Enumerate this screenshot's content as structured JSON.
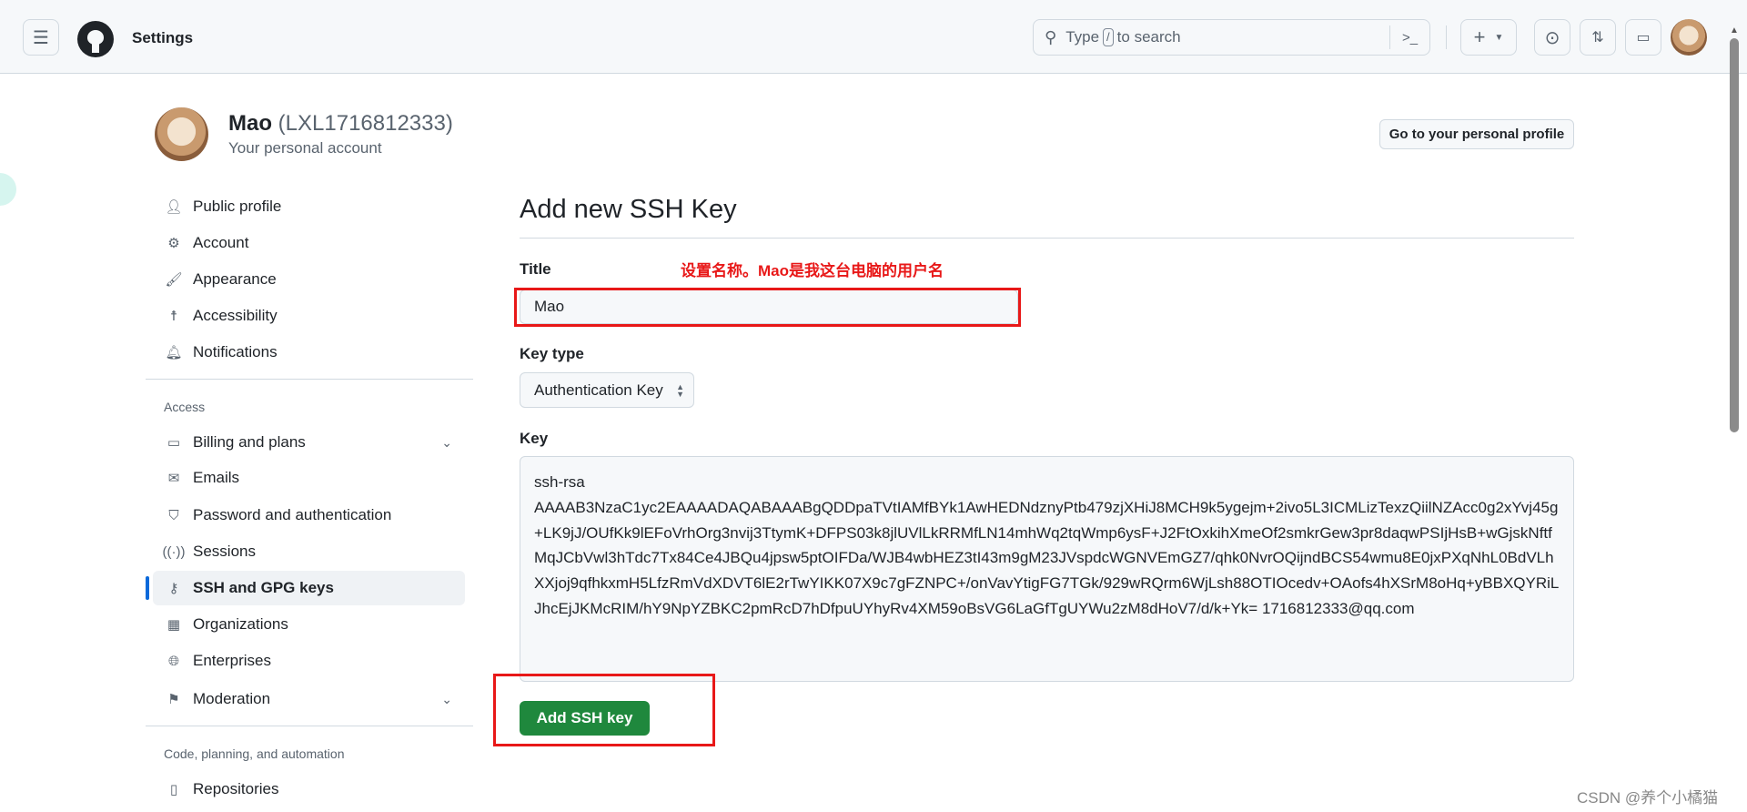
{
  "header": {
    "title": "Settings",
    "search_placeholder_pre": "Type",
    "search_key": "/",
    "search_placeholder_post": "to search"
  },
  "account": {
    "name": "Mao",
    "login": "(LXL1716812333)",
    "subtitle": "Your personal account",
    "profile_button": "Go to your personal profile"
  },
  "sidebar": {
    "items": [
      {
        "label": "Public profile",
        "icon": "person-icon"
      },
      {
        "label": "Account",
        "icon": "gear-icon"
      },
      {
        "label": "Appearance",
        "icon": "paintbrush-icon"
      },
      {
        "label": "Accessibility",
        "icon": "accessibility-icon"
      },
      {
        "label": "Notifications",
        "icon": "bell-icon"
      }
    ],
    "access_heading": "Access",
    "access_items": [
      {
        "label": "Billing and plans",
        "icon": "credit-card-icon"
      },
      {
        "label": "Emails",
        "icon": "mail-icon"
      },
      {
        "label": "Password and authentication",
        "icon": "shield-icon"
      },
      {
        "label": "Sessions",
        "icon": "broadcast-icon"
      },
      {
        "label": "SSH and GPG keys",
        "icon": "key-icon",
        "selected": true
      },
      {
        "label": "Organizations",
        "icon": "organization-icon"
      },
      {
        "label": "Enterprises",
        "icon": "globe-icon"
      },
      {
        "label": "Moderation",
        "icon": "report-icon"
      }
    ],
    "code_heading": "Code, planning, and automation",
    "code_items": [
      {
        "label": "Repositories",
        "icon": "repo-icon"
      }
    ]
  },
  "main": {
    "heading": "Add new SSH Key",
    "title_label": "Title",
    "title_value": "Mao",
    "annotation": "设置名称。Mao是我这台电脑的用户名",
    "key_type_label": "Key type",
    "key_type_value": "Authentication Key",
    "key_label": "Key",
    "key_value": "ssh-rsa\nAAAAB3NzaC1yc2EAAAADAQABAAABgQDDpaTVtIAMfBYk1AwHEDNdznyPtb479zjXHiJ8MCH9k5ygejm+2ivo5L3ICMLizTexzQiilNZAcc0g2xYvj45g+LK9jJ/OUfKk9lEFoVrhOrg3nvij3TtymK+DFPS03k8jlUVlLkRRMfLN14mhWq2tqWmp6ysF+J2FtOxkihXmeOf2smkrGew3pr8daqwPSIjHsB+wGjskNftfMqJCbVwl3hTdc7Tx84Ce4JBQu4jpsw5ptOIFDa/WJB4wbHEZ3tI43m9gM23JVspdcWGNVEmGZ7/qhk0NvrOQijndBCS54wmu8E0jxPXqNhL0BdVLhXXjoj9qfhkxmH5LfzRmVdXDVT6lE2rTwYIKK07X9c7gFZNPC+/onVavYtigFG7TGk/929wRQrm6WjLsh88OTIOcedv+OAofs4hXSrM8oHq+yBBXQYRiLJhcEjJKMcRIM/hY9NpYZBKC2pmRcD7hDfpuUYhyRv4XM59oBsVG6LaGfTgUYWu2zM8dHoV7/d/k+Yk= 1716812333@qq.com",
    "submit": "Add SSH key"
  },
  "watermark": "CSDN @养个小橘猫",
  "colors": {
    "accent": "#0969da",
    "primary_button": "#1f883d",
    "annotation": "#e81818"
  }
}
